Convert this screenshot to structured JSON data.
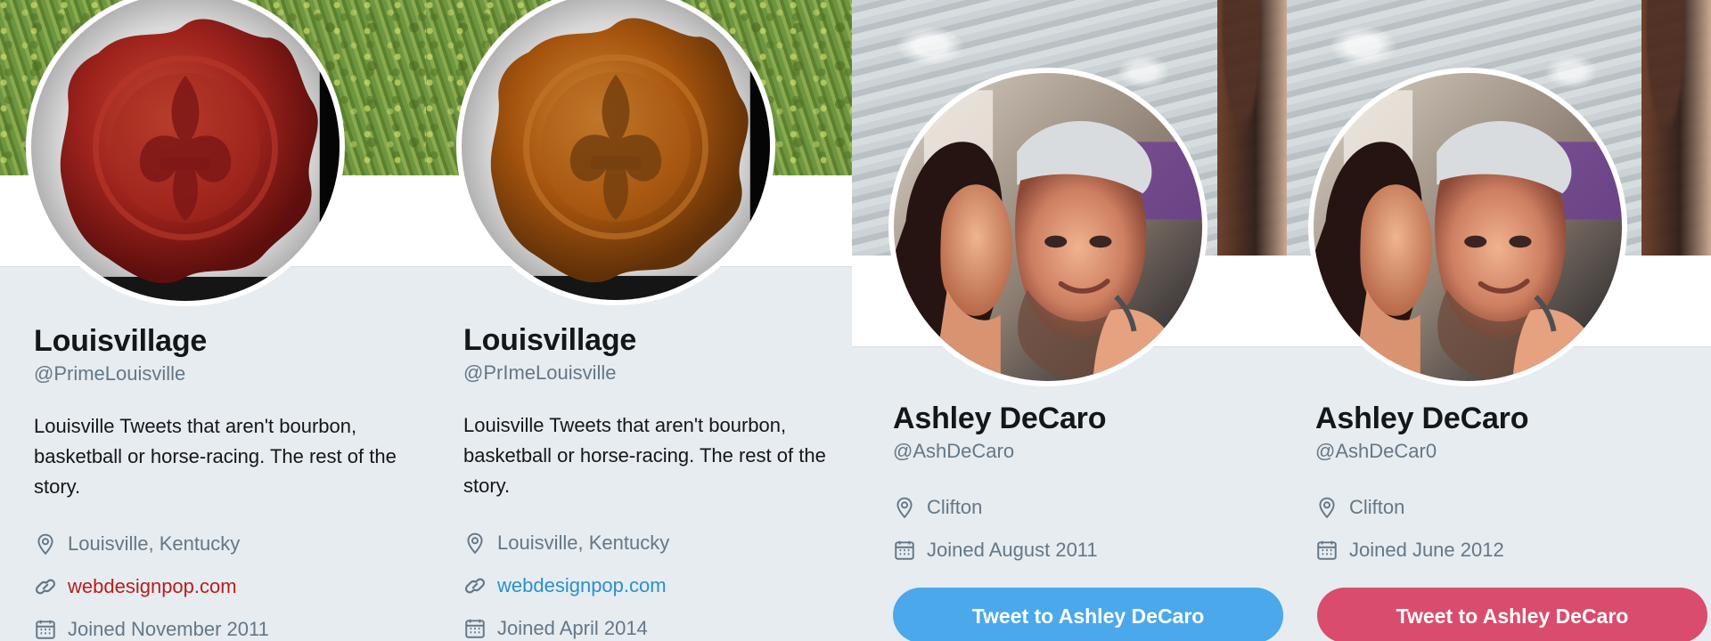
{
  "colors": {
    "page_background": "#e6ecf0",
    "text_primary": "#14171a",
    "text_secondary": "#657786",
    "red_link": "#b81e1e",
    "blue_link": "#2a91c9",
    "blue_button": "#4aa8eb",
    "pink_button": "#d94c6d",
    "red_seal": "#a8271e",
    "orange_seal": "#a9560d"
  },
  "profiles": [
    {
      "name": "Louisvillage",
      "handle": "@PrimeLouisville",
      "bio": "Louisville Tweets that aren't bourbon, basketball or horse-racing. The rest of the story.",
      "location": "Louisville, Kentucky",
      "website": "webdesignpop.com",
      "joined": "Joined November 2011",
      "banner": "grass",
      "avatar": "red-wax-seal-fleur-de-lis"
    },
    {
      "name": "Louisvillage",
      "handle": "@PrImeLouisville",
      "bio": "Louisville Tweets that aren't bourbon, basketball or horse-racing. The rest of the story.",
      "location": "Louisville, Kentucky",
      "website": "webdesignpop.com",
      "joined": "Joined April 2014",
      "banner": "grass",
      "avatar": "orange-wax-seal-fleur-de-lis"
    },
    {
      "name": "Ashley DeCaro",
      "handle": "@AshDeCaro",
      "location": "Clifton",
      "joined": "Joined August 2011",
      "button": "Tweet to Ashley DeCaro",
      "banner": "water",
      "avatar": "couple-selfie"
    },
    {
      "name": "Ashley DeCaro",
      "handle": "@AshDeCar0",
      "location": "Clifton",
      "joined": "Joined June 2012",
      "button": "Tweet to Ashley DeCaro",
      "banner": "water",
      "avatar": "couple-selfie"
    }
  ],
  "icons": {
    "location": "location-pin-icon",
    "website": "link-icon",
    "joined": "calendar-icon"
  }
}
